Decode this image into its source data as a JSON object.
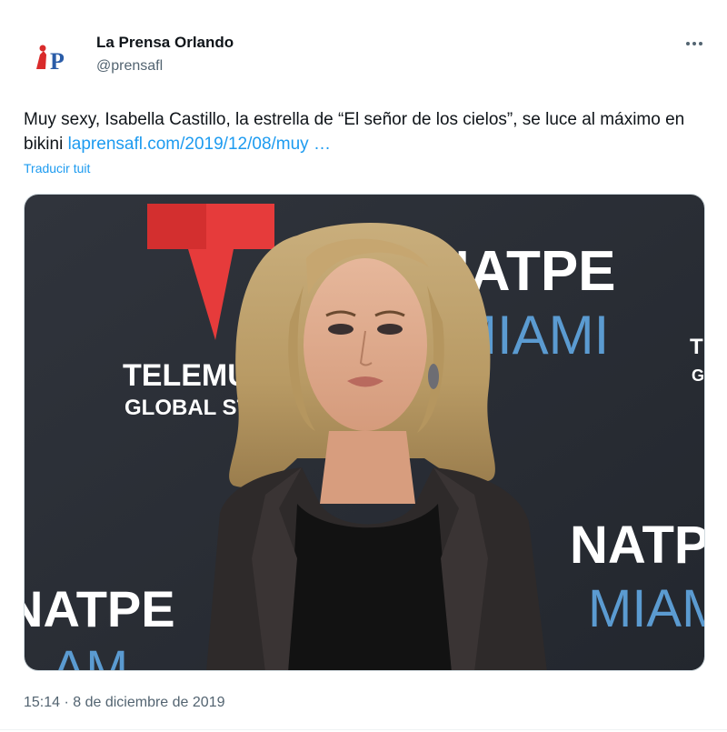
{
  "author": {
    "display_name": "La Prensa Orlando",
    "handle": "@prensafl",
    "avatar_letter": "P"
  },
  "tweet": {
    "text_before_link": "Muy sexy, Isabella Castillo, la estrella de “El señor de los cielos”, se luce al máximo en bikini  ",
    "link_text": "laprensafl.com/2019/12/08/muy …",
    "translate_label": "Traducir tuit",
    "timestamp": "15:14 · 8 de diciembre de 2019"
  },
  "media": {
    "backdrop_texts": {
      "telemundo_line1": "TELEMUNI",
      "telemundo_line2": "GLOBAL STUD",
      "natpe_top": "NATPE",
      "miami_top": "MIAMI",
      "natpe_bottom_right": "NATPE",
      "miami_bottom_right": "MIAM",
      "natpe_bottom_left": "NATPE",
      "miami_bottom_left": "AM",
      "edge_t": "T",
      "edge_g": "G"
    }
  },
  "colors": {
    "accent": "#1d9bf0",
    "logo_red": "#d92b2b",
    "logo_blue": "#2a5ca8",
    "backdrop": "#2b3038",
    "telemundo_red": "#e63b3b"
  },
  "icons": {
    "more": "more-horizontal-icon",
    "avatar": "la-prensa-logo-icon"
  }
}
